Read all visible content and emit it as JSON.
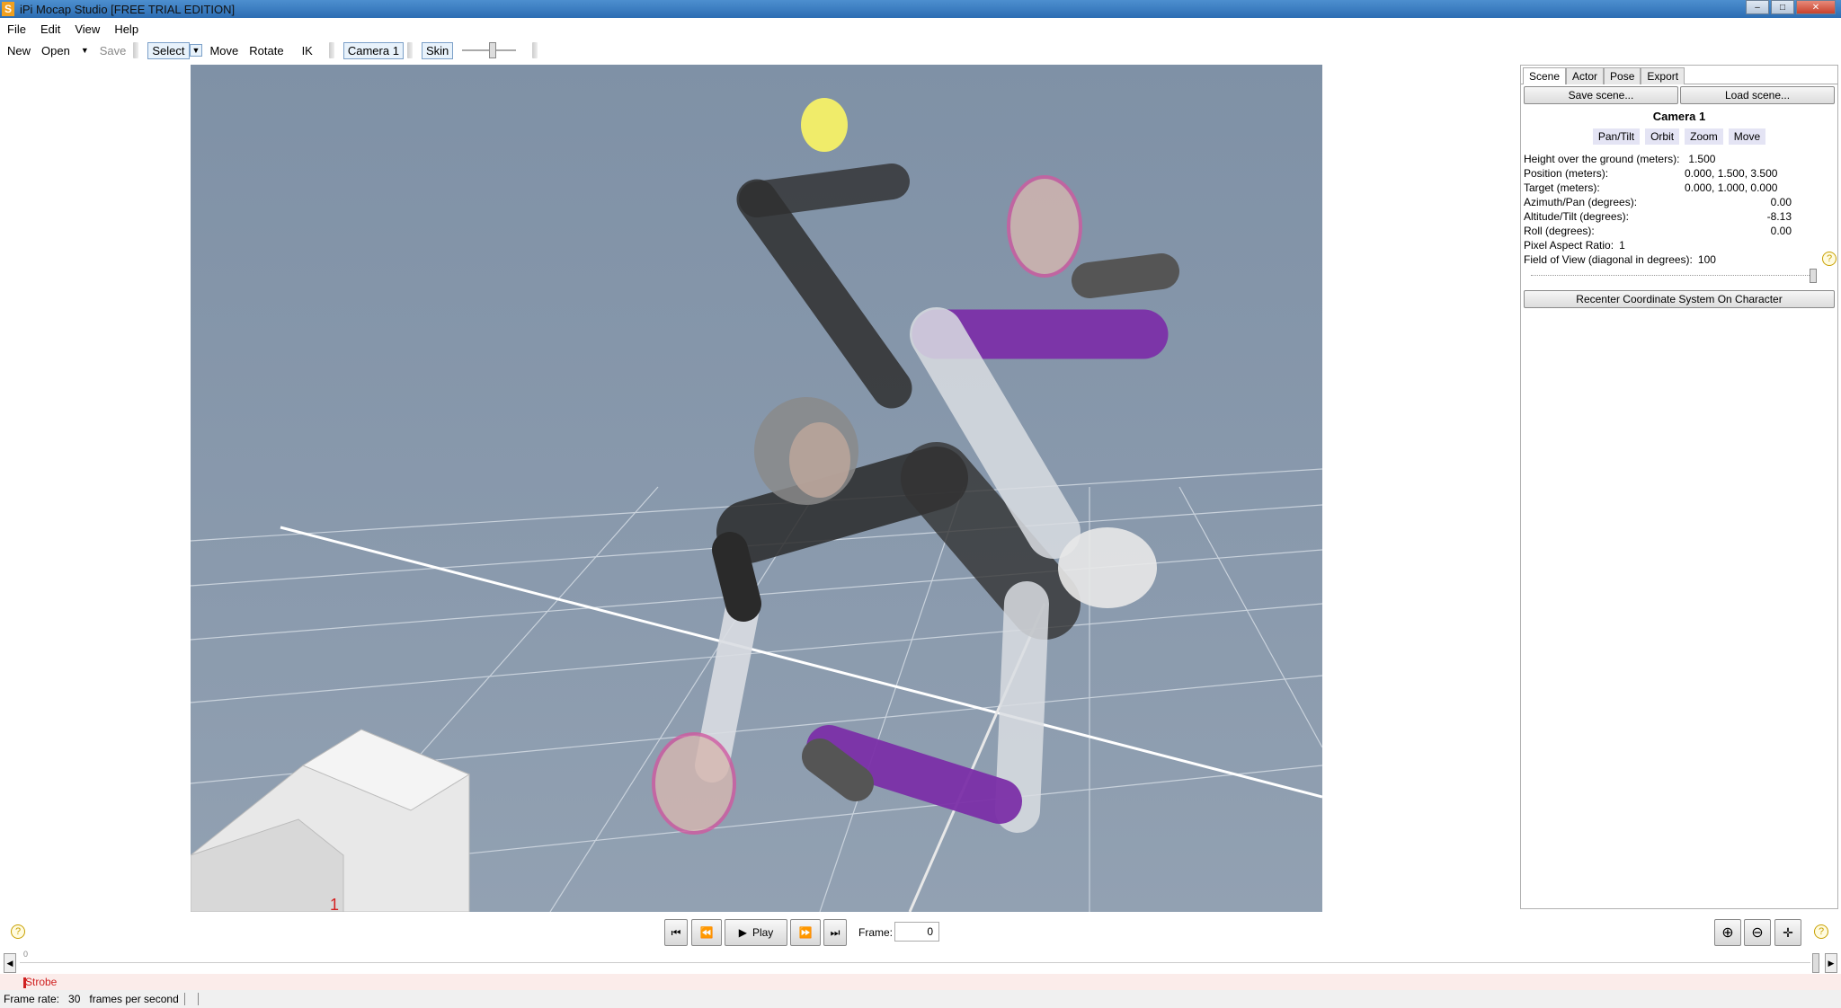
{
  "window": {
    "title": "iPi Mocap Studio [FREE TRIAL EDITION]",
    "app_icon": "S"
  },
  "menu": {
    "file": "File",
    "edit": "Edit",
    "view": "View",
    "help": "Help"
  },
  "toolbar": {
    "new": "New",
    "open": "Open",
    "save": "Save",
    "select": "Select",
    "move": "Move",
    "rotate": "Rotate",
    "ik": "IK",
    "camera": "Camera 1",
    "skin": "Skin"
  },
  "viewport": {
    "ground_marker": "1"
  },
  "side": {
    "tabs": [
      "Scene",
      "Actor",
      "Pose",
      "Export"
    ],
    "save_scene": "Save scene...",
    "load_scene": "Load scene...",
    "camera_title": "Camera 1",
    "nav": [
      "Pan/Tilt",
      "Orbit",
      "Zoom",
      "Move"
    ],
    "props": {
      "height_label": "Height over the ground (meters):",
      "height_value": "1.500",
      "position_label": "Position (meters):",
      "position_value": "0.000, 1.500, 3.500",
      "target_label": "Target (meters):",
      "target_value": "0.000, 1.000, 0.000",
      "azimuth_label": "Azimuth/Pan (degrees):",
      "azimuth_value": "0.00",
      "altitude_label": "Altitude/Tilt (degrees):",
      "altitude_value": "-8.13",
      "roll_label": "Roll (degrees):",
      "roll_value": "0.00",
      "aspect_label": "Pixel Aspect Ratio:",
      "aspect_value": "1",
      "fov_label": "Field of View (diagonal in degrees):",
      "fov_value": "100"
    },
    "recenter": "Recenter Coordinate System On Character"
  },
  "playback": {
    "play": "Play",
    "frame_label": "Frame:",
    "frame_value": "0"
  },
  "timeline": {
    "start_tick": "0",
    "strobe": "Strobe"
  },
  "status": {
    "frame_rate_label": "Frame rate:",
    "frame_rate_value": "30",
    "frame_rate_unit": "frames per second"
  },
  "colors": {
    "viewport_bg": "#8393a7",
    "suit_purple": "#7b2fa8",
    "sun": "#f0ec6a"
  }
}
